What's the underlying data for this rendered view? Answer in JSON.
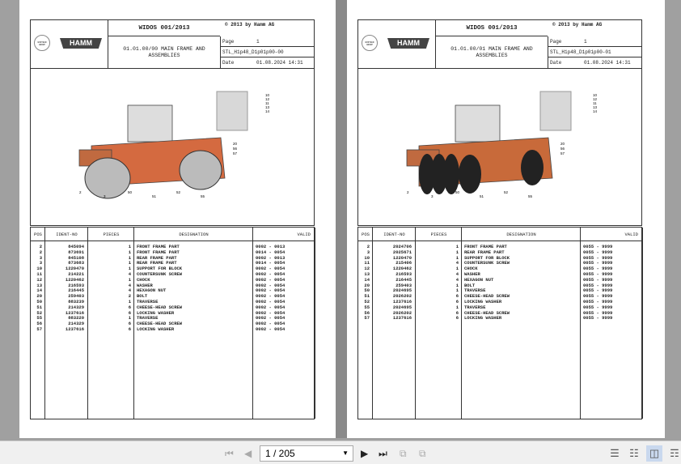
{
  "pages": [
    {
      "title": "WIDOS 001/2013",
      "copyright": "© 2013 by Hamm AG",
      "logo_hamm": "HAMM",
      "logo_wirtgen": "WIRTGEN GROUP",
      "desc1": "01.01.00/00 MAIN FRAME AND",
      "desc2": "ASSEMBLIES",
      "page_label": "Page",
      "page_value": "1",
      "doc_id": "STL_H1p48_D1p01p00-00",
      "date_label": "Date",
      "date_value": "01.08.2024  14:31",
      "callouts": [
        "10",
        "12",
        "11",
        "13",
        "14",
        "20",
        "56",
        "57",
        "2",
        "3",
        "50",
        "51",
        "52",
        "55"
      ],
      "headers": [
        "POS",
        "IDENT-NO",
        "PIECES",
        "DESIGNATION",
        "VALID"
      ],
      "rows": [
        [
          "2",
          "845094",
          "1",
          "FRONT FRAME PART",
          "0002 - 0013"
        ],
        [
          "2",
          "873691",
          "1",
          "FRONT FRAME PART",
          "0014 - 0054"
        ],
        [
          "3",
          "845108",
          "1",
          "REAR FRAME PART",
          "0002 - 0013"
        ],
        [
          "3",
          "873683",
          "1",
          "REAR FRAME PART",
          "0014 - 0054"
        ],
        [
          "10",
          "1220470",
          "1",
          "SUPPORT FOR BLOCK",
          "0002 - 0054"
        ],
        [
          "11",
          "214221",
          "4",
          "COUNTERSUNK SCREW",
          "0002 - 0054"
        ],
        [
          "12",
          "1220462",
          "1",
          "CHOCK",
          "0002 - 0054"
        ],
        [
          "13",
          "216593",
          "4",
          "WASHER",
          "0002 - 0054"
        ],
        [
          "14",
          "216445",
          "4",
          "HEXAGON NUT",
          "0002 - 0054"
        ],
        [
          "20",
          "259403",
          "2",
          "BOLT",
          "0002 - 0054"
        ],
        [
          "50",
          "883239",
          "1",
          "TRAVERSE",
          "0002 - 0054"
        ],
        [
          "51",
          "214329",
          "6",
          "CHEESE-HEAD SCREW",
          "0002 - 0054"
        ],
        [
          "52",
          "1237616",
          "6",
          "LOCKING WASHER",
          "0002 - 0054"
        ],
        [
          "55",
          "883220",
          "1",
          "TRAVERSE",
          "0002 - 0054"
        ],
        [
          "56",
          "214329",
          "6",
          "CHEESE-HEAD SCREW",
          "0002 - 0054"
        ],
        [
          "57",
          "1237616",
          "6",
          "LOCKING WASHER",
          "0002 - 0054"
        ]
      ]
    },
    {
      "title": "WIDOS 001/2013",
      "copyright": "© 2013 by Hamm AG",
      "logo_hamm": "HAMM",
      "logo_wirtgen": "WIRTGEN GROUP",
      "desc1": "01.01.00/01 MAIN FRAME AND",
      "desc2": "ASSEMBLIES",
      "page_label": "Page",
      "page_value": "1",
      "doc_id": "STL_H1p48_D1p01p00-01",
      "date_label": "Date",
      "date_value": "01.08.2024  14:31",
      "callouts": [
        "10",
        "12",
        "11",
        "13",
        "14",
        "20",
        "56",
        "57",
        "2",
        "3",
        "50",
        "51",
        "52",
        "55"
      ],
      "headers": [
        "POS",
        "IDENT-NO",
        "PIECES",
        "DESIGNATION",
        "VALID"
      ],
      "rows": [
        [
          "2",
          "2024706",
          "1",
          "FRONT FRAME PART",
          "0055 - 9999"
        ],
        [
          "3",
          "2025671",
          "1",
          "REAR FRAME PART",
          "0055 - 9999"
        ],
        [
          "10",
          "1220470",
          "1",
          "SUPPORT FOR BLOCK",
          "0055 - 9999"
        ],
        [
          "11",
          "215406",
          "4",
          "COUNTERSUNK SCREW",
          "0055 - 9999"
        ],
        [
          "12",
          "1220462",
          "1",
          "CHOCK",
          "0055 - 9999"
        ],
        [
          "13",
          "216593",
          "4",
          "WASHER",
          "0055 - 9999"
        ],
        [
          "14",
          "216445",
          "4",
          "HEXAGON NUT",
          "0055 - 9999"
        ],
        [
          "20",
          "259403",
          "1",
          "BOLT",
          "0055 - 9999"
        ],
        [
          "50",
          "2024695",
          "1",
          "TRAVERSE",
          "0055 - 9999"
        ],
        [
          "51",
          "2026202",
          "6",
          "CHEESE-HEAD SCREW",
          "0055 - 9999"
        ],
        [
          "52",
          "1237616",
          "6",
          "LOCKING WASHER",
          "0055 - 9999"
        ],
        [
          "55",
          "2024695",
          "1",
          "TRAVERSE",
          "0055 - 9999"
        ],
        [
          "56",
          "2026202",
          "6",
          "CHEESE-HEAD SCREW",
          "0055 - 9999"
        ],
        [
          "57",
          "1237616",
          "6",
          "LOCKING WASHER",
          "0055 - 9999"
        ]
      ]
    }
  ],
  "toolbar": {
    "page_input": "1 / 205"
  }
}
